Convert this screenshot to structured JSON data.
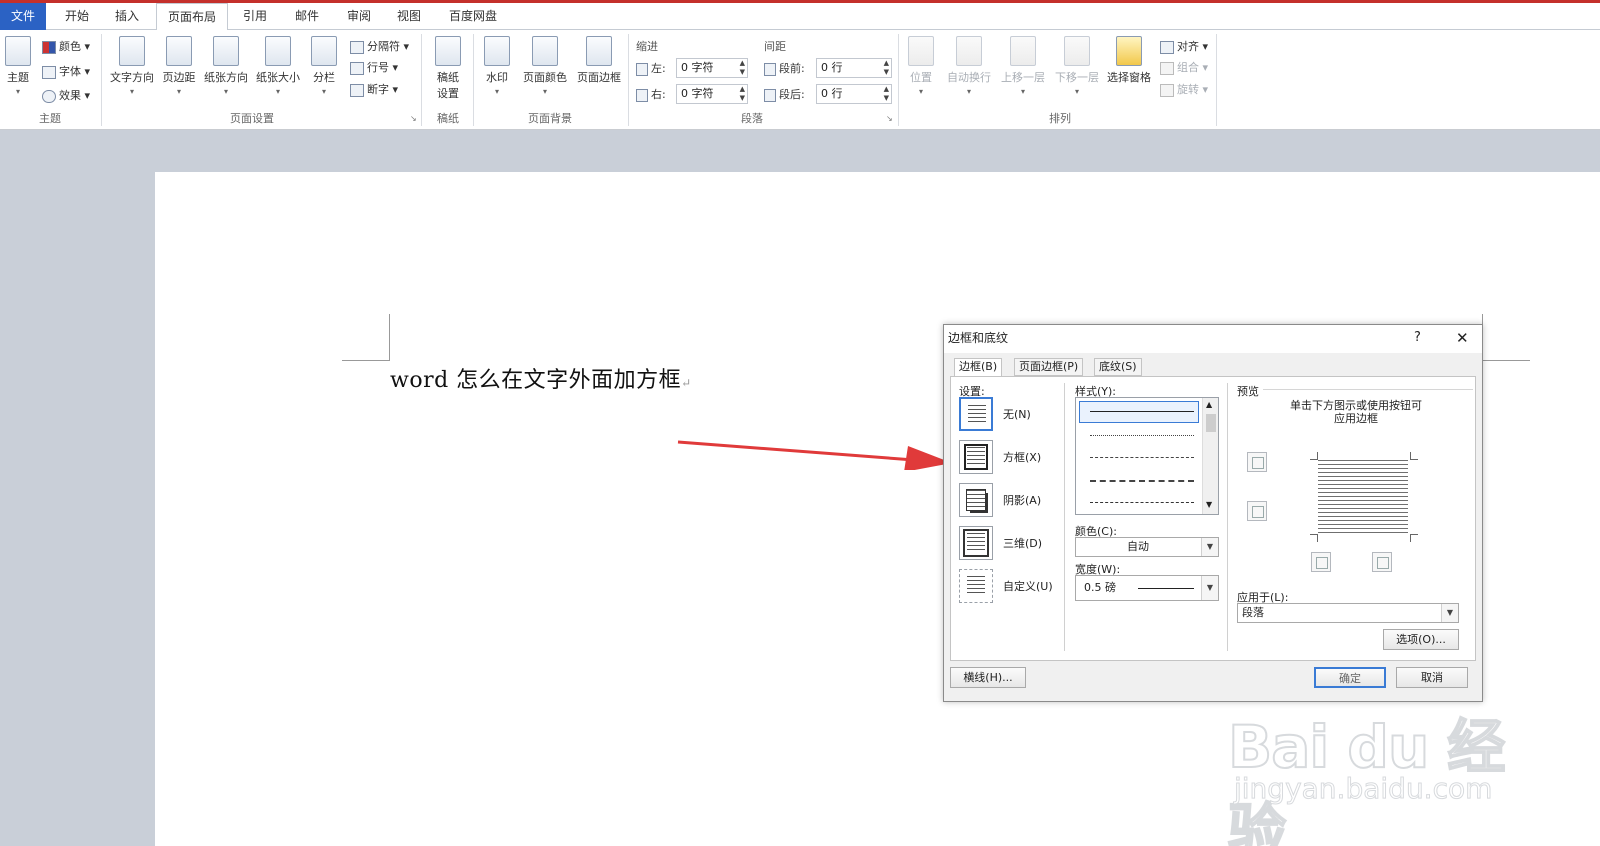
{
  "tabs": [
    "文件",
    "开始",
    "插入",
    "页面布局",
    "引用",
    "邮件",
    "审阅",
    "视图",
    "百度网盘"
  ],
  "active_tab": "页面布局",
  "ribbon": {
    "theme_group": {
      "label": "主题",
      "main": "主题",
      "colors": "颜色",
      "fonts": "字体",
      "effects": "效果"
    },
    "page_setup": {
      "label": "页面设置",
      "text_direction": "文字方向",
      "margins": "页边距",
      "orientation": "纸张方向",
      "size": "纸张大小",
      "columns": "分栏",
      "breaks": "分隔符",
      "line_numbers": "行号",
      "hyphenation": "断字"
    },
    "manuscript": {
      "label": "稿纸",
      "settings_line1": "稿纸",
      "settings_line2": "设置"
    },
    "page_background": {
      "label": "页面背景",
      "watermark": "水印",
      "page_color": "页面颜色",
      "page_borders": "页面边框"
    },
    "paragraph": {
      "label": "段落",
      "indent_title": "缩进",
      "indent_left_label": "左:",
      "indent_left_value": "0 字符",
      "indent_right_label": "右:",
      "indent_right_value": "0 字符",
      "spacing_title": "间距",
      "before_label": "段前:",
      "before_value": "0 行",
      "after_label": "段后:",
      "after_value": "0 行"
    },
    "arrange": {
      "label": "排列",
      "position": "位置",
      "wrap_text": "自动换行",
      "bring_forward": "上移一层",
      "send_backward": "下移一层",
      "selection_pane": "选择窗格",
      "align": "对齐",
      "group": "组合",
      "rotate": "旋转"
    }
  },
  "document": {
    "text": "word 怎么在文字外面加方框",
    "para_mark": "↵"
  },
  "dialog": {
    "title": "边框和底纹",
    "help": "?",
    "close": "✕",
    "tabs": [
      "边框(B)",
      "页面边框(P)",
      "底纹(S)"
    ],
    "settings_label": "设置:",
    "settings": [
      "无(N)",
      "方框(X)",
      "阴影(A)",
      "三维(D)",
      "自定义(U)"
    ],
    "style_label": "样式(Y):",
    "color_label": "颜色(C):",
    "color_value": "自动",
    "width_label": "宽度(W):",
    "width_value": "0.5 磅",
    "preview_label": "预览",
    "preview_hint_line1": "单击下方图示或使用按钮可",
    "preview_hint_line2": "应用边框",
    "apply_label": "应用于(L):",
    "apply_value": "段落",
    "options_button": "选项(O)...",
    "hline_button": "横线(H)...",
    "ok_button": "确定",
    "cancel_button": "取消"
  },
  "watermark": {
    "logo": "Bai du 经验",
    "url": "jingyan.baidu.com"
  },
  "colors": {
    "file_tab": "#2b62c4",
    "arrow": "#e03a3a",
    "accent": "#3a7bd5"
  }
}
